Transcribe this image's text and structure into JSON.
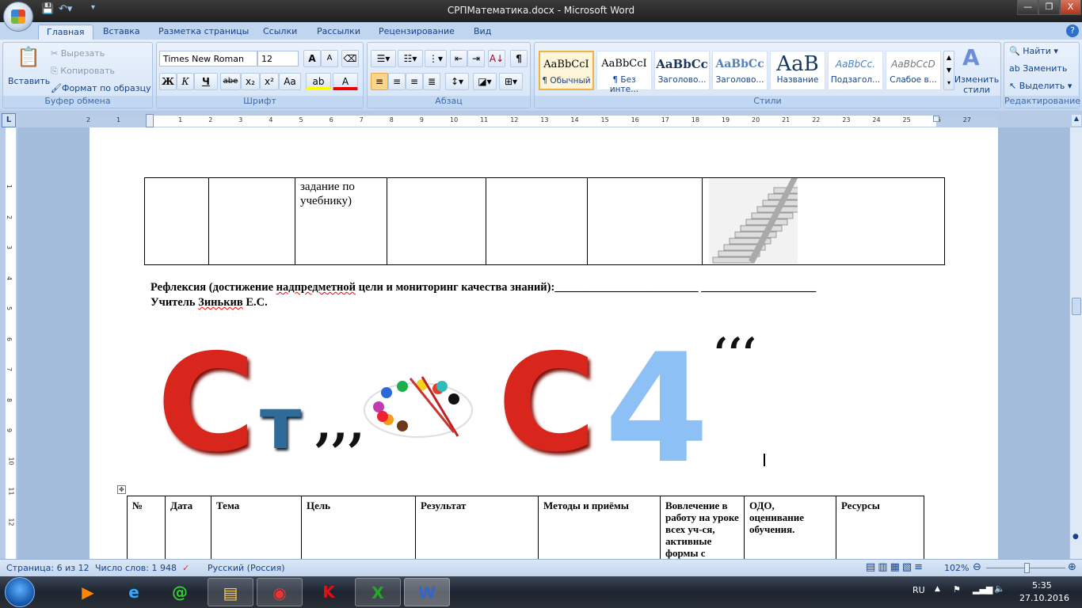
{
  "window": {
    "title": "СРПМатематика.docx - Microsoft Word",
    "minimize": "—",
    "restore": "❐",
    "close": "X"
  },
  "tabs": [
    "Главная",
    "Вставка",
    "Разметка страницы",
    "Ссылки",
    "Рассылки",
    "Рецензирование",
    "Вид"
  ],
  "clipboard": {
    "label": "Буфер обмена",
    "paste": "Вставить",
    "cut": "Вырезать",
    "copy": "Копировать",
    "format_painter": "Формат по образцу"
  },
  "font": {
    "label": "Шрифт",
    "name": "Times New Roman",
    "size": "12",
    "bold": "Ж",
    "italic": "К",
    "underline": "Ч",
    "strike": "abe",
    "sub": "x₂",
    "sup": "x²",
    "case": "Aa",
    "grow": "A",
    "shrink": "A",
    "highlight": "ab",
    "color": "A",
    "highlight_color": "#ffff00",
    "font_color": "#e00000"
  },
  "paragraph": {
    "label": "Абзац"
  },
  "styles": {
    "label": "Стили",
    "items": [
      {
        "preview": "AaBbCcI",
        "name": "¶ Обычный"
      },
      {
        "preview": "AaBbCcI",
        "name": "¶ Без инте..."
      },
      {
        "preview": "AaBbCc",
        "name": "Заголово..."
      },
      {
        "preview": "AaBbCc",
        "name": "Заголово..."
      },
      {
        "preview": "AaB",
        "name": "Название"
      },
      {
        "preview": "AaBbCc.",
        "name": "Подзагол..."
      },
      {
        "preview": "AaBbCcD",
        "name": "Слабое в..."
      }
    ],
    "change": "Изменить стили"
  },
  "editing": {
    "label": "Редактирование",
    "find": "Найти",
    "replace": "Заменить",
    "select": "Выделить"
  },
  "ruler": {
    "ticks": [
      "2",
      "1",
      "1",
      "2",
      "3",
      "4",
      "5",
      "6",
      "7",
      "8",
      "9",
      "10",
      "11",
      "12",
      "13",
      "14",
      "15",
      "16",
      "17",
      "18",
      "19",
      "20",
      "21",
      "22",
      "23",
      "24",
      "25",
      "26",
      "27"
    ]
  },
  "vruler": {
    "ticks": [
      "1",
      "2",
      "3",
      "4",
      "5",
      "6",
      "7",
      "8",
      "9",
      "10",
      "11",
      "12"
    ]
  },
  "document": {
    "table1_cell": [
      "задание по",
      "учебнику)"
    ],
    "reflection": "Рефлексия (достижение  ",
    "reflection_sq": "надпредметной",
    "reflection_rest": "  цели и мониторинг  качества знаний):_________________________  ____________________",
    "teacher_a": "Учитель ",
    "teacher_sq": "Зинькив",
    "teacher_b": "  Е.С.",
    "rebus": {
      "c1": "С",
      "t": "т",
      "commas1": ",,,",
      "c2": "С",
      "four": "4",
      "commas2": "ʻʻʻ"
    },
    "table2_headers": [
      "№",
      "Дата",
      "Тема",
      "Цель",
      "Результат",
      "Методы и приёмы",
      "Вовлечение в работу на уроке всех уч-ся, активные формы с",
      "ОДО, оценивание обучения.",
      "Ресурсы"
    ]
  },
  "status": {
    "page": "Страница: 6 из 12",
    "words": "Число слов: 1 948",
    "language": "Русский (Россия)",
    "zoom": "102%",
    "zoom_value": 102
  },
  "taskbar": {
    "lang": "RU",
    "time": "5:35",
    "date": "27.10.2016"
  }
}
